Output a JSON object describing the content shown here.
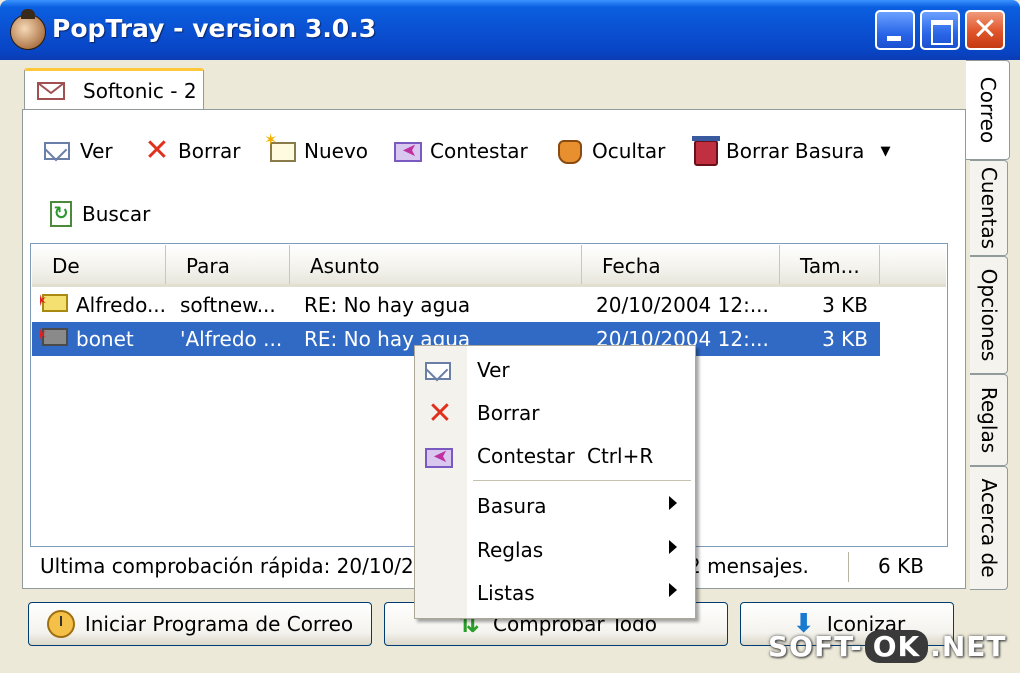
{
  "window": {
    "title": "PopTray - version 3.0.3"
  },
  "doc_tab": {
    "label": "Softonic - 2"
  },
  "toolbar": {
    "ver": "Ver",
    "borrar": "Borrar",
    "nuevo": "Nuevo",
    "contestar": "Contestar",
    "ocultar": "Ocultar",
    "borrar_basura": "Borrar Basura",
    "buscar": "Buscar"
  },
  "list": {
    "columns": [
      "De",
      "Para",
      "Asunto",
      "Fecha",
      "Tam..."
    ],
    "rows": [
      {
        "de": "Alfredo...",
        "para": "softnew...",
        "asunto": "RE: No hay agua",
        "fecha": "20/10/2004 12:...",
        "tam": "3 KB",
        "selected": false
      },
      {
        "de": "bonet",
        "para": "'Alfredo ...",
        "asunto": "RE: No hay agua",
        "fecha": "20/10/2004 12:...",
        "tam": "3 KB",
        "selected": true
      }
    ]
  },
  "status": {
    "left": "Ultima comprobación rápida: 20/10/200",
    "mid": "2 mensajes.",
    "right": "6 KB"
  },
  "buttons": {
    "iniciar": "Iniciar Programa de Correo",
    "comprobar": "Comprobar Todo",
    "iconizar": "Iconizar"
  },
  "side_tabs": [
    "Correo",
    "Cuentas",
    "Opciones",
    "Reglas",
    "Acerca de"
  ],
  "context_menu": {
    "ver": "Ver",
    "borrar": "Borrar",
    "contestar": "Contestar",
    "contestar_shortcut": "Ctrl+R",
    "basura": "Basura",
    "reglas": "Reglas",
    "listas": "Listas"
  },
  "watermark": {
    "a": "SOFT-",
    "b": "OK",
    "c": ".NET"
  },
  "colors": {
    "titlebar": "#0a4fd0",
    "selection": "#316ac5",
    "face": "#ece9d8",
    "tab_highlight": "#ffc83c"
  }
}
